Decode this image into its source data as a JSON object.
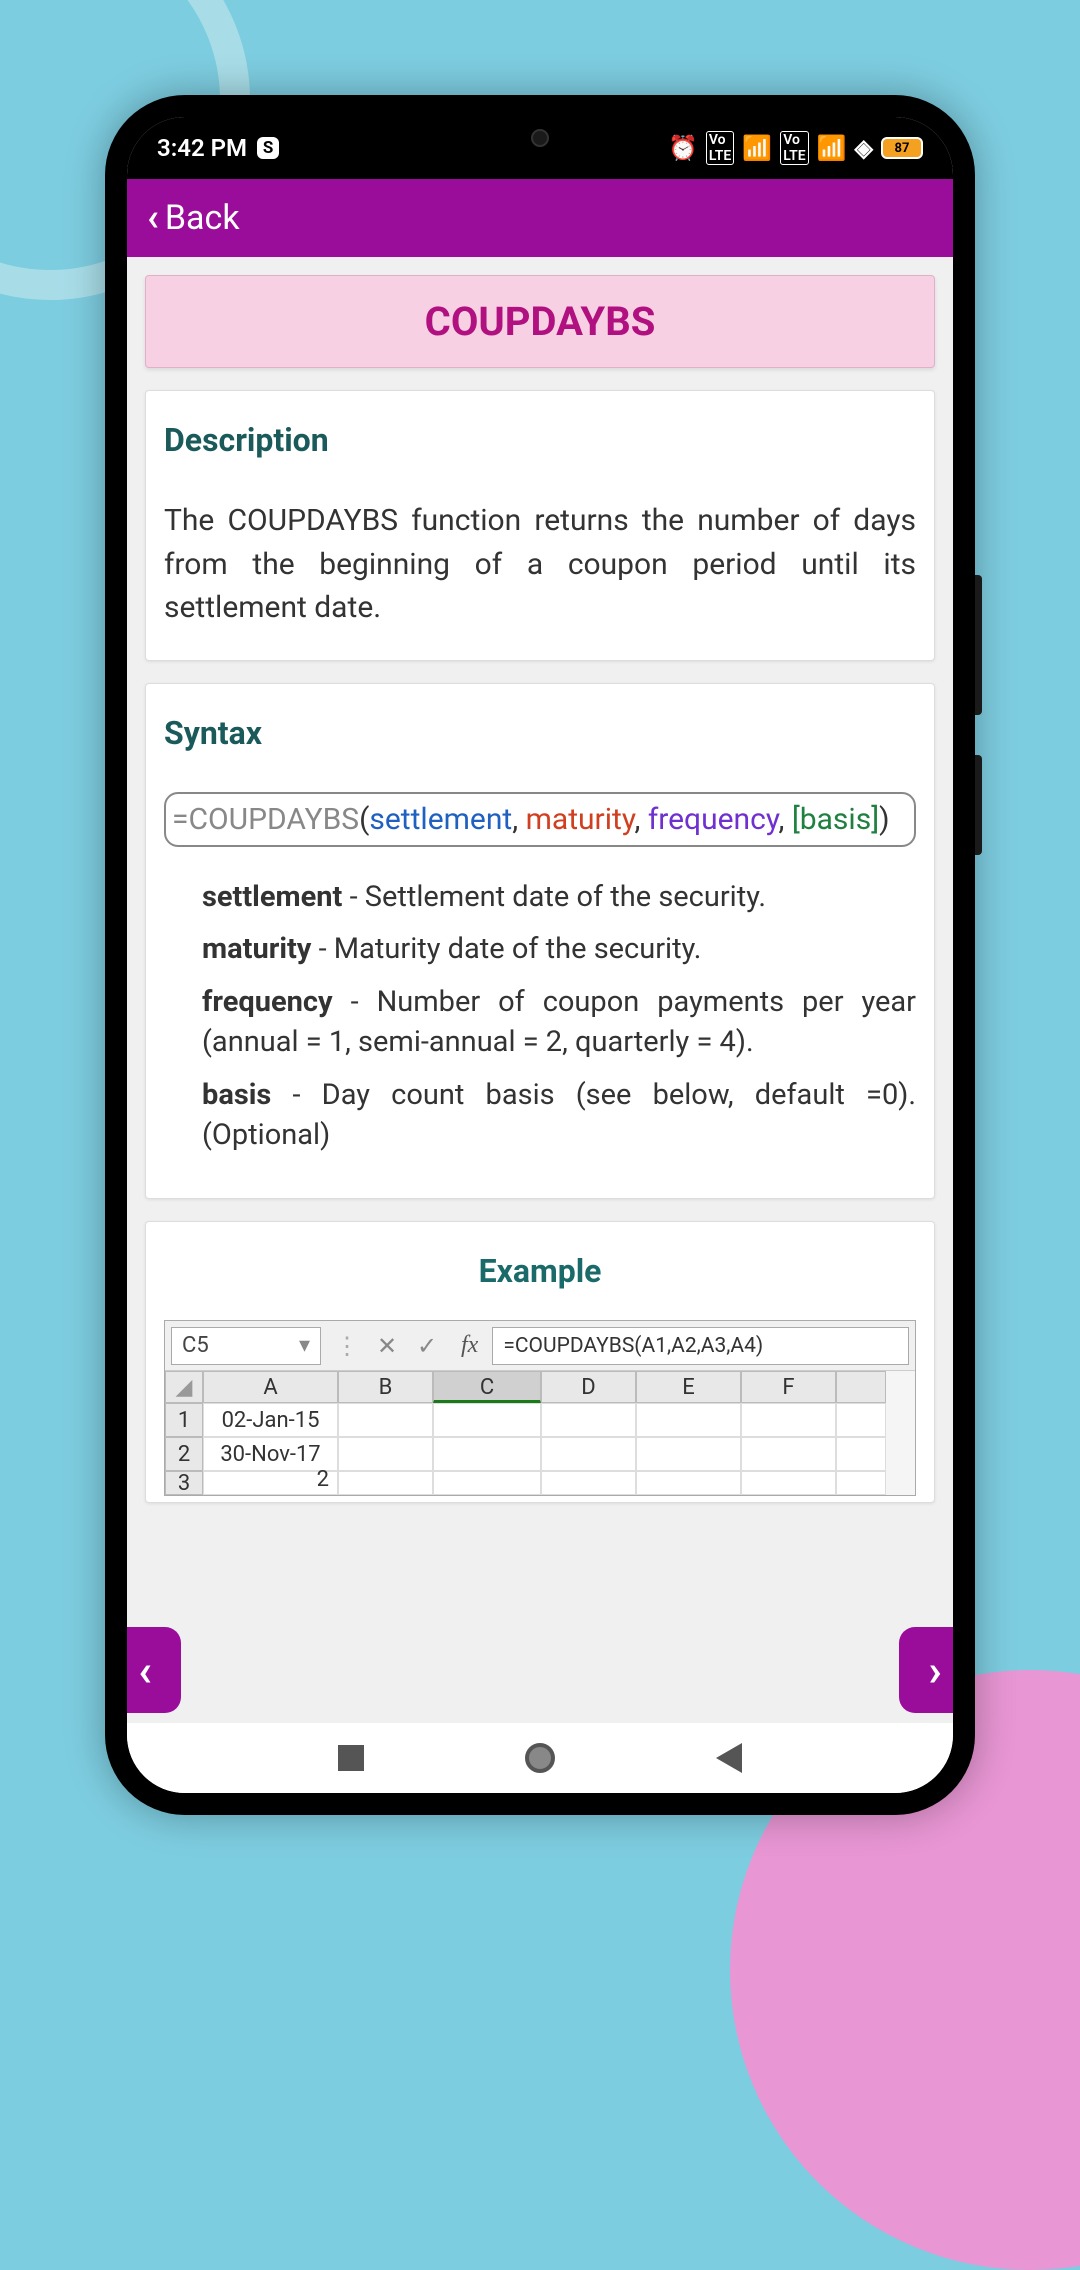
{
  "statusBar": {
    "time": "3:42 PM",
    "sIcon": "S",
    "battery": "87"
  },
  "header": {
    "backLabel": "Back"
  },
  "title": "COUPDAYBS",
  "description": {
    "heading": "Description",
    "text": "The COUPDAYBS function returns the number of days from the beginning of a coupon period until its settlement date."
  },
  "syntax": {
    "heading": "Syntax",
    "formula": {
      "eq": "=",
      "fn": "COUPDAYBS",
      "open": "(",
      "arg1": "settlement",
      "arg2": "maturity",
      "arg3": "frequency",
      "arg4": "[basis]",
      "close": ")",
      "comma": ", "
    },
    "params": [
      {
        "name": "settlement",
        "desc": " - Settlement date of the security."
      },
      {
        "name": "maturity",
        "desc": " - Maturity date of the security."
      },
      {
        "name": "frequency",
        "desc": " - Number of coupon payments per year (annual = 1, semi-annual = 2, quarterly = 4)."
      },
      {
        "name": "basis",
        "desc": " - Day count basis (see below, default =0). (Optional)"
      }
    ]
  },
  "example": {
    "heading": "Example",
    "nameBox": "C5",
    "formulaBar": "=COUPDAYBS(A1,A2,A3,A4)",
    "cols": [
      "A",
      "B",
      "C",
      "D",
      "E",
      "F",
      ""
    ],
    "rows": [
      {
        "num": "1",
        "a": "02-Jan-15"
      },
      {
        "num": "2",
        "a": "30-Nov-17"
      },
      {
        "num": "3",
        "a": "2"
      }
    ]
  }
}
